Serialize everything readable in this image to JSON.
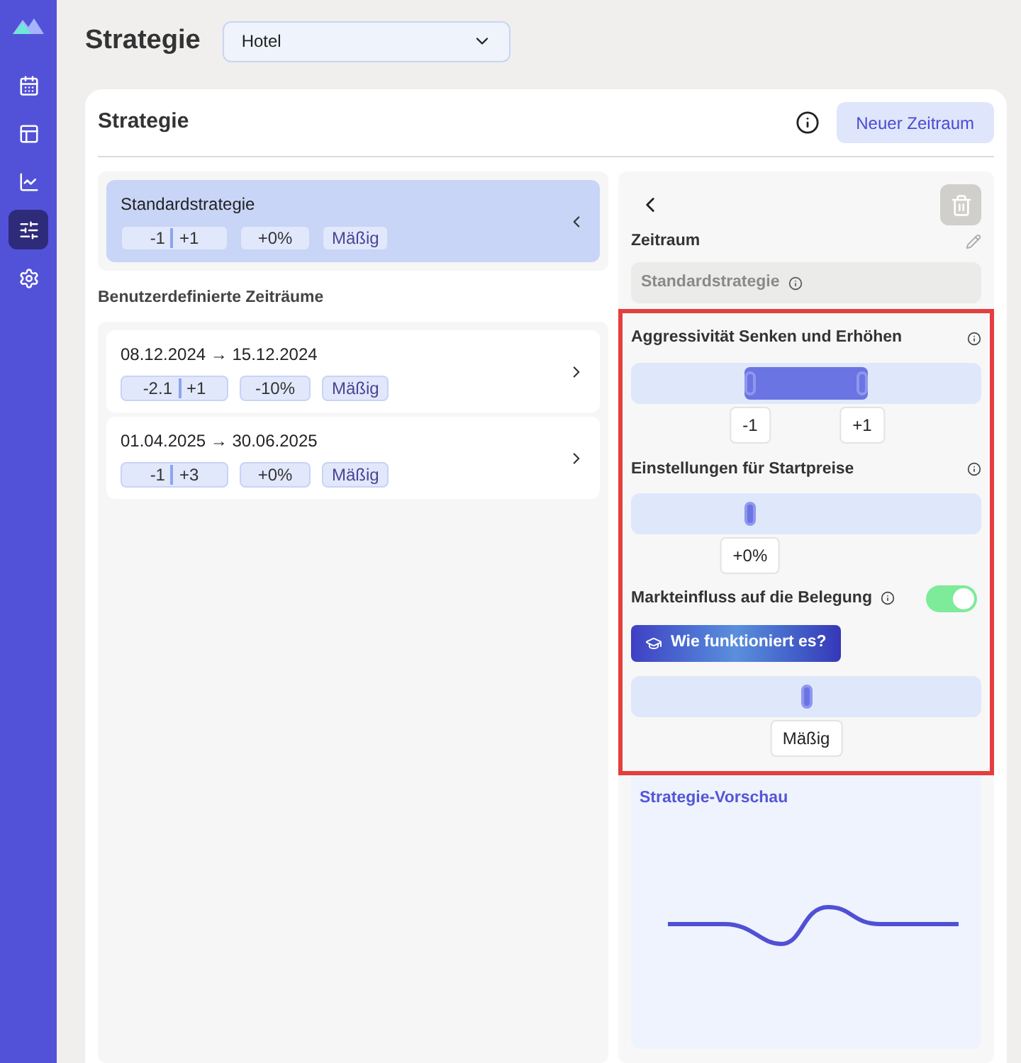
{
  "sidebar": {
    "items": [
      {
        "kind": "calendar",
        "selected": false
      },
      {
        "kind": "layout",
        "selected": false
      },
      {
        "kind": "chart",
        "selected": false
      },
      {
        "kind": "sliders",
        "selected": true
      },
      {
        "kind": "settings",
        "selected": false
      }
    ]
  },
  "header": {
    "title": "Strategie",
    "property_select": {
      "value": "Hotel"
    }
  },
  "card": {
    "title": "Strategie",
    "new_button": "Neuer Zeitraum"
  },
  "default_strategy": {
    "name": "Standardstrategie",
    "selected": true,
    "range": {
      "low": "-1",
      "high": "+1"
    },
    "start": "+0%",
    "market": "Mäßig"
  },
  "custom_title": "Benutzerdefinierte Zeiträume",
  "periods": [
    {
      "dates": "08.12.2024 → 15.12.2024",
      "selected": false,
      "range": {
        "low": "-2.1",
        "high": "+1"
      },
      "start": "-10%",
      "market": "Mäßig"
    },
    {
      "dates": "01.04.2025 → 30.06.2025",
      "selected": false,
      "range": {
        "low": "-1",
        "high": "+3"
      },
      "start": "+0%",
      "market": "Mäßig"
    }
  ],
  "detail": {
    "period_label": "Zeitraum",
    "period_value": "Standardstrategie",
    "aggressiveness": {
      "label": "Aggressivität Senken und Erhöhen",
      "handles": [
        {
          "level": 0.34,
          "reading": "-1"
        },
        {
          "level": 0.66,
          "reading": "+1"
        }
      ]
    },
    "start_prices": {
      "label": "Einstellungen für Startpreise",
      "level": 0.34,
      "reading": "+0%"
    },
    "market": {
      "label": "Markteinfluss auf die Belegung",
      "on": true,
      "help_button": "Wie funktioniert es?",
      "level": 0.5,
      "reading": "Mäßig"
    },
    "preview": {
      "title": "Strategie-Vorschau"
    }
  }
}
